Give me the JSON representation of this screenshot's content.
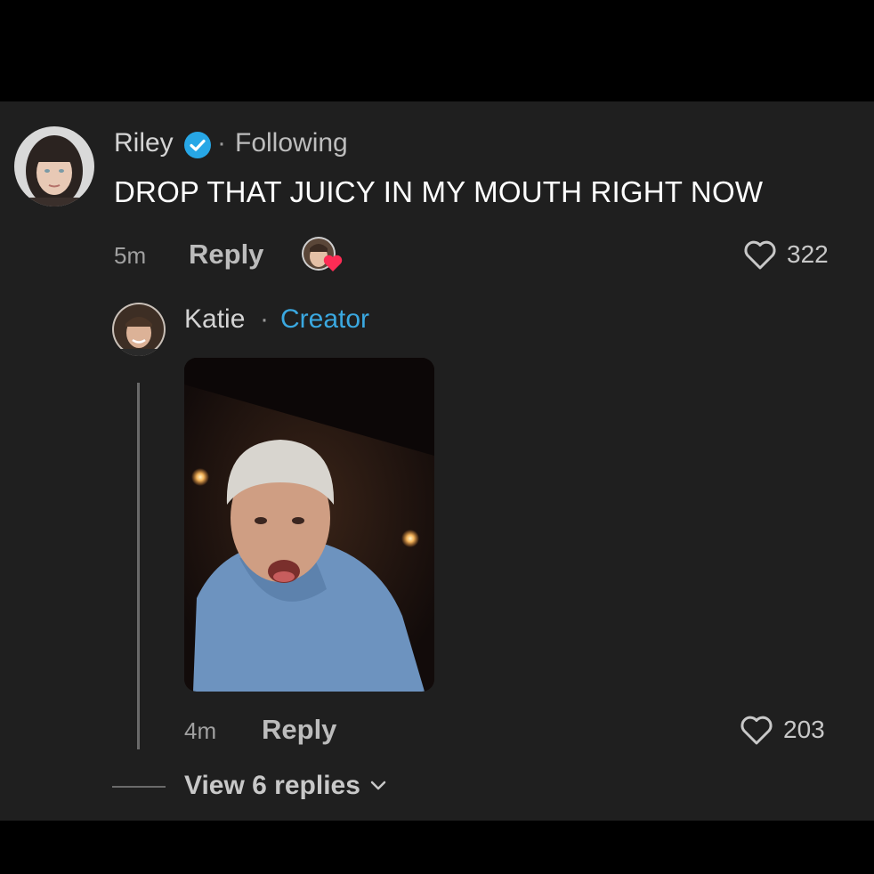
{
  "comment": {
    "author": "Riley",
    "verified_icon": "verified-check-icon",
    "separator": "·",
    "relation": "Following",
    "text": "DROP THAT JUICY IN MY MOUTH RIGHT NOW",
    "time": "5m",
    "reply_label": "Reply",
    "like_count": "322",
    "liked_by_creator_icon": "creator-liked-heart-icon"
  },
  "reply": {
    "author": "Katie",
    "separator": "·",
    "badge": "Creator",
    "time": "4m",
    "reply_label": "Reply",
    "like_count": "203"
  },
  "thread": {
    "view_replies_label": "View 6 replies"
  },
  "colors": {
    "background": "#000000",
    "panel": "#1f1f1f",
    "creator_accent": "#3aa8e0",
    "verified": "#27a7e6",
    "heart_badge": "#fe2c55"
  }
}
